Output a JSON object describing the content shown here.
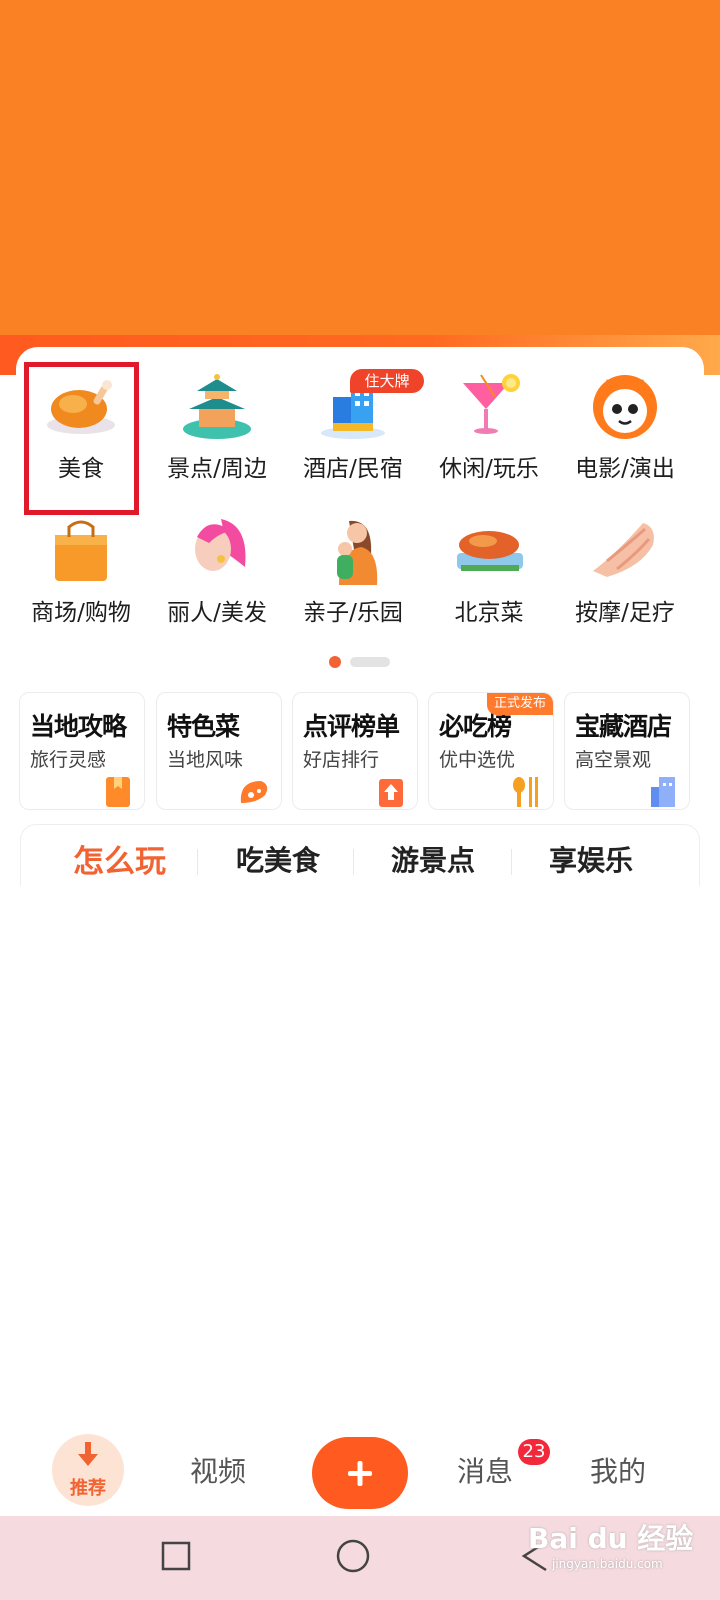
{
  "categories": [
    {
      "label": "美食",
      "icon": "roast-chicken-icon"
    },
    {
      "label": "景点/周边",
      "icon": "pavilion-icon"
    },
    {
      "label": "酒店/民宿",
      "icon": "hotel-building-icon"
    },
    {
      "label": "休闲/玩乐",
      "icon": "cocktail-icon"
    },
    {
      "label": "电影/演出",
      "icon": "cat-face-icon"
    },
    {
      "label": "商场/购物",
      "icon": "shopping-bag-icon"
    },
    {
      "label": "丽人/美发",
      "icon": "woman-hair-icon"
    },
    {
      "label": "亲子/乐园",
      "icon": "mother-child-icon"
    },
    {
      "label": "北京菜",
      "icon": "roast-duck-icon"
    },
    {
      "label": "按摩/足疗",
      "icon": "massage-hand-icon"
    }
  ],
  "hotel_tag": "住大牌",
  "cards": [
    {
      "title": "当地攻略",
      "subtitle": "旅行灵感",
      "icon": "bookmark-icon"
    },
    {
      "title": "特色菜",
      "subtitle": "当地风味",
      "icon": "shrimp-icon"
    },
    {
      "title": "点评榜单",
      "subtitle": "好店排行",
      "icon": "ranking-icon"
    },
    {
      "title": "必吃榜",
      "subtitle": "优中选优",
      "icon": "utensils-icon",
      "tag": "正式发布"
    },
    {
      "title": "宝藏酒店",
      "subtitle": "高空景观",
      "icon": "hotel-icon"
    }
  ],
  "tabs": [
    "怎么玩",
    "吃美食",
    "游景点",
    "享娱乐"
  ],
  "active_tab": "怎么玩",
  "bottom_nav": {
    "recommend": "推荐",
    "video": "视频",
    "messages": "消息",
    "messages_badge": "23",
    "mine": "我的"
  },
  "watermark": {
    "logo": "Bai du 经验",
    "url": "jingyan.baidu.com"
  },
  "colors": {
    "accent": "#f26333",
    "banner": "#fb8125",
    "highlight": "#e01a2a"
  }
}
